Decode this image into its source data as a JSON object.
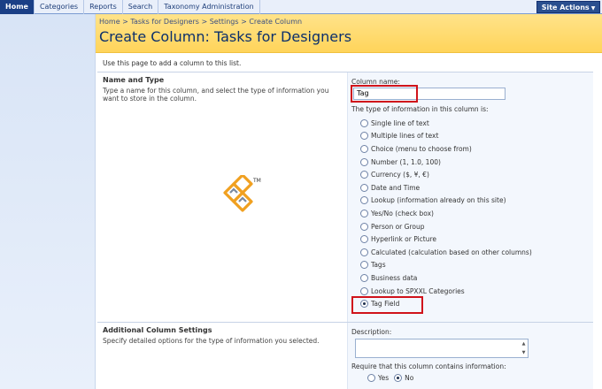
{
  "topnav": {
    "tabs": [
      {
        "label": "Home",
        "active": true
      },
      {
        "label": "Categories",
        "active": false
      },
      {
        "label": "Reports",
        "active": false
      },
      {
        "label": "Search",
        "active": false
      },
      {
        "label": "Taxonomy Administration",
        "active": false
      }
    ],
    "site_actions": "Site Actions"
  },
  "banner": {
    "breadcrumb": "Home > Tasks for Designers > Settings > Create Column",
    "title": "Create Column: Tasks for Designers"
  },
  "intro": "Use this page to add a column to this list.",
  "name_type": {
    "title": "Name and Type",
    "description": "Type a name for this column, and select the type of information you want to store in the column.",
    "column_name_label": "Column name:",
    "column_name_value": "Tag",
    "type_label": "The type of information in this column is:",
    "types": [
      {
        "label": "Single line of text",
        "checked": false
      },
      {
        "label": "Multiple lines of text",
        "checked": false
      },
      {
        "label": "Choice (menu to choose from)",
        "checked": false
      },
      {
        "label": "Number (1, 1.0, 100)",
        "checked": false
      },
      {
        "label": "Currency ($, ¥, €)",
        "checked": false
      },
      {
        "label": "Date and Time",
        "checked": false
      },
      {
        "label": "Lookup (information already on this site)",
        "checked": false
      },
      {
        "label": "Yes/No (check box)",
        "checked": false
      },
      {
        "label": "Person or Group",
        "checked": false
      },
      {
        "label": "Hyperlink or Picture",
        "checked": false
      },
      {
        "label": "Calculated (calculation based on other columns)",
        "checked": false
      },
      {
        "label": "Tags",
        "checked": false
      },
      {
        "label": "Business data",
        "checked": false
      },
      {
        "label": "Lookup to SPXXL Categories",
        "checked": false
      },
      {
        "label": "Tag Field",
        "checked": true
      }
    ]
  },
  "additional": {
    "title": "Additional Column Settings",
    "description": "Specify detailed options for the type of information you selected.",
    "description_label": "Description:",
    "required_label": "Require that this column contains information:",
    "yes_label": "Yes",
    "no_label": "No",
    "required_value": "No"
  },
  "colors": {
    "accent": "#1a3f86",
    "banner": "#ffd45a",
    "highlight": "#d0131b"
  }
}
